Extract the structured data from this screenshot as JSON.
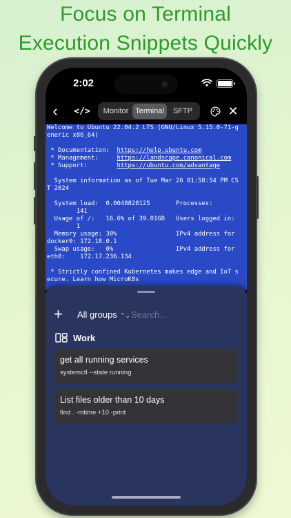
{
  "headline": {
    "line1": "Focus on Terminal",
    "line2": "Execution Snippets Quickly"
  },
  "status_bar": {
    "time": "2:02"
  },
  "nav": {
    "back_icon": "chevron-left-icon",
    "code_icon": "code-brackets-icon",
    "tabs": [
      {
        "label": "Monitor",
        "active": false
      },
      {
        "label": "Terminal",
        "active": true
      },
      {
        "label": "SFTP",
        "active": false
      }
    ],
    "palette_icon": "palette-icon",
    "close_icon": "close-icon"
  },
  "terminal": {
    "background_color": "#2a49c6",
    "lines": [
      "Welcome to Ubuntu 22.04.2 LTS (GNU/Linux 5.15.0-71-g",
      "eneric x86_64)",
      "",
      " * Documentation:  ",
      " * Management:     ",
      " * Support:        ",
      "",
      "  System information as of Tue Mar 26 01:58:54 PM CS",
      "T 2024",
      "",
      "  System load:  0.0048828125       Processes:",
      "        141",
      "  Usage of /:   16.6% of 39.01GB   Users logged in:",
      "        1",
      "  Memory usage: 30%                IPv4 address for",
      "docker0: 172.18.0.1",
      "  Swap usage:   0%                 IPv4 address for",
      "eth0:    172.17.236.134",
      "",
      " * Strictly confined Kubernetes makes edge and IoT s",
      "ecure. Learn how MicroK8s"
    ],
    "links": {
      "documentation": "https://help.ubuntu.com",
      "management": "https://landscape.canonical.com",
      "support": "https://ubuntu.com/advantage"
    }
  },
  "sheet": {
    "add_icon": "plus-icon",
    "group_selector": "All groups",
    "group_selector_icon": "chevron-up-down-icon",
    "search_placeholder": "Search...",
    "group": {
      "icon": "group-icon",
      "title": "Work",
      "snippets": [
        {
          "title": "get all running services",
          "command": "systemctl --state running"
        },
        {
          "title": "List files older than 10 days",
          "command": "find . -mtime +10 -print"
        }
      ]
    }
  }
}
